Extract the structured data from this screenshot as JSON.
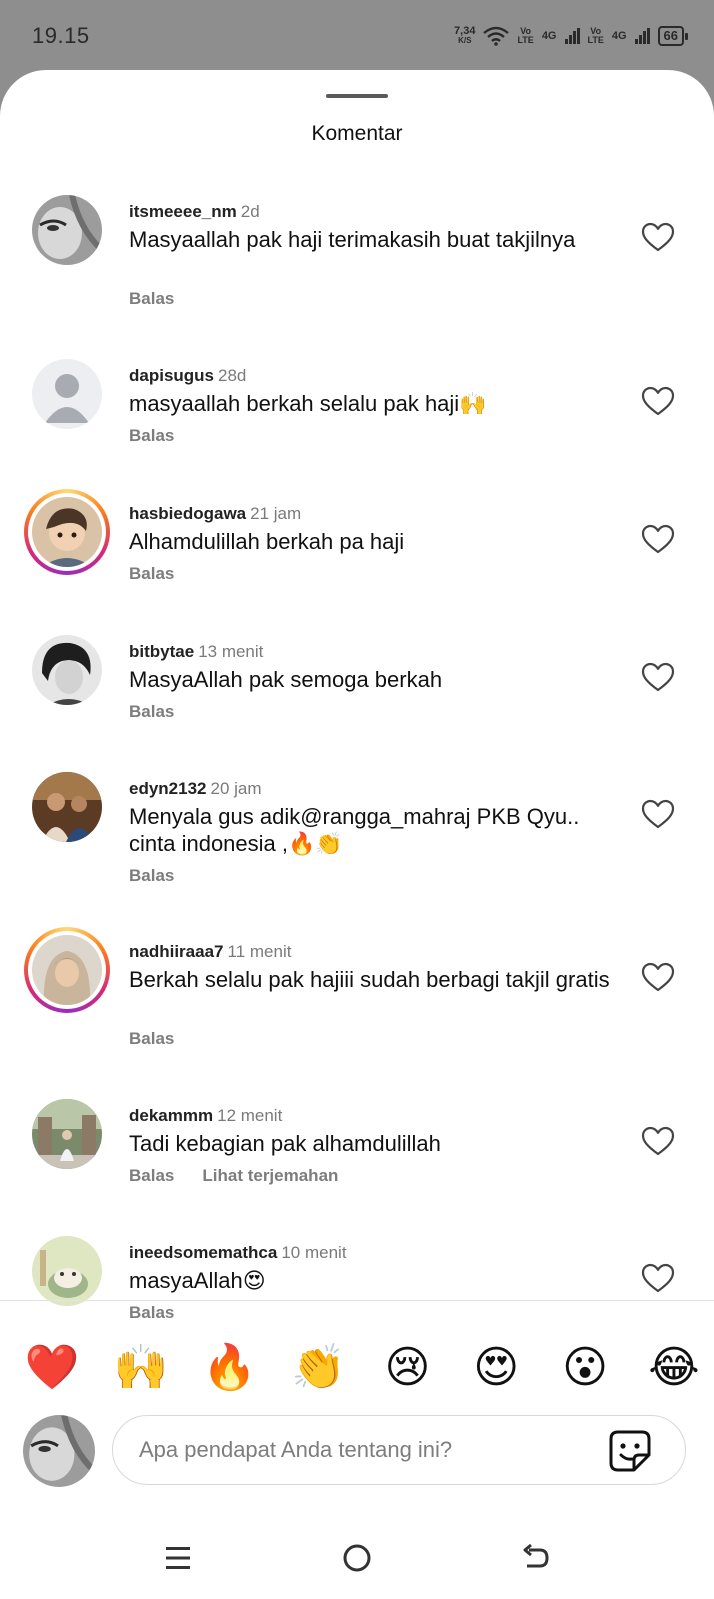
{
  "status": {
    "time": "19.15",
    "net_speed": "7,34",
    "net_unit": "K/S",
    "net1_top": "Vo",
    "net1_bottom": "LTE",
    "net1_gen": "4G",
    "net2_top": "Vo",
    "net2_bottom": "LTE",
    "net2_gen": "4G",
    "battery": "66"
  },
  "sheet": {
    "title": "Komentar"
  },
  "comments": [
    {
      "username": "itsmeeee_nm",
      "time": "2d",
      "text": "Masyaallah pak haji terimakasih buat takjilnya",
      "reply": "Balas"
    },
    {
      "username": "dapisugus",
      "time": "28d",
      "text": "masyaallah berkah selalu pak haji🙌",
      "reply": "Balas"
    },
    {
      "username": "hasbiedogawa",
      "time": "21 jam",
      "text": "Alhamdulillah berkah pa haji",
      "reply": "Balas"
    },
    {
      "username": "bitbytae",
      "time": "13 menit",
      "text": "MasyaAllah pak semoga berkah",
      "reply": "Balas"
    },
    {
      "username": "edyn2132",
      "time": "20 jam",
      "text": "Menyala gus adik@rangga_mahraj  PKB Qyu.. cinta indonesia ,🔥👏",
      "reply": "Balas"
    },
    {
      "username": "nadhiiraaa7",
      "time": "11 menit",
      "text": "Berkah selalu pak hajiii sudah berbagi takjil gratis",
      "reply": "Balas"
    },
    {
      "username": "dekammm",
      "time": "12 menit",
      "text": "Tadi kebagian pak alhamdulillah",
      "reply": "Balas",
      "translate": "Lihat terjemahan"
    },
    {
      "username": "ineedsomemathca",
      "time": "10 menit",
      "text": "masyaAllah😍",
      "reply": "Balas"
    }
  ],
  "emoji_bar": [
    "❤️",
    "🙌",
    "🔥",
    "👏",
    "😢",
    "😍",
    "😮",
    "😂"
  ],
  "composer": {
    "placeholder": "Apa pendapat Anda tentang ini?"
  },
  "icons": {
    "heart": "heart-outline-icon",
    "sticker": "sticker-icon",
    "nav_menu": "menu-icon",
    "nav_home": "home-circle-icon",
    "nav_back": "back-icon"
  },
  "colors": {
    "status_bg": "#8e8e8e",
    "sheet_bg": "#ffffff",
    "story_ring_start": "#feda75",
    "story_ring_mid": "#d62976",
    "secondary_text": "#7d7d7d"
  }
}
